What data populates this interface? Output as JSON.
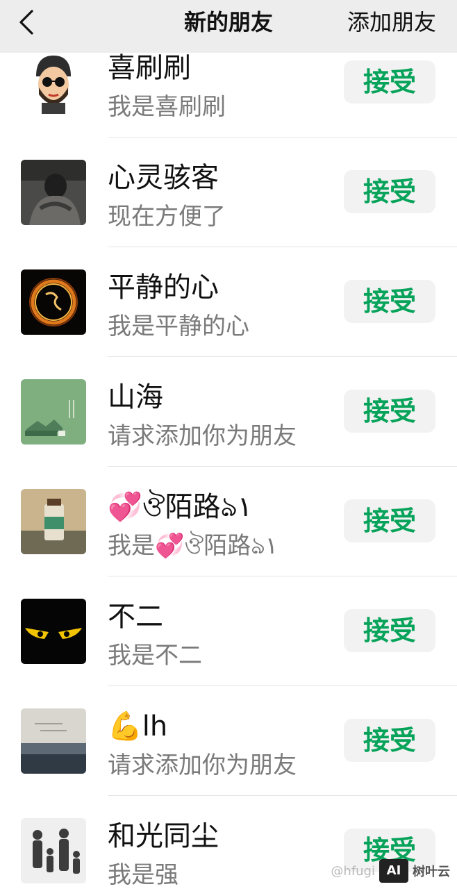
{
  "header": {
    "title": "新的朋友",
    "action_label": "添加朋友"
  },
  "requests": [
    {
      "name": "喜刷刷",
      "message": "我是喜刷刷",
      "accept_label": "接受"
    },
    {
      "name": "心灵骇客",
      "message": "现在方便了",
      "accept_label": "接受"
    },
    {
      "name": "平静的心",
      "message": "我是平静的心",
      "accept_label": "接受"
    },
    {
      "name": "山海",
      "message": "请求添加你为朋友",
      "accept_label": "接受"
    },
    {
      "name": "💞ঔ陌路ঌ١",
      "message": "我是💞ঔ陌路ঌ١",
      "accept_label": "接受"
    },
    {
      "name": "不二",
      "message": "我是不二",
      "accept_label": "接受"
    },
    {
      "name": "💪lh",
      "message": "请求添加你为朋友",
      "accept_label": "接受"
    },
    {
      "name": "和光同尘",
      "message": "我是强",
      "accept_label": "接受"
    }
  ],
  "watermark": {
    "handle": "@hfugi",
    "logo": "AI",
    "brand": "树叶云"
  },
  "colors": {
    "accent": "#07a35a",
    "header_bg": "#ededed",
    "button_bg": "#f2f2f2"
  }
}
